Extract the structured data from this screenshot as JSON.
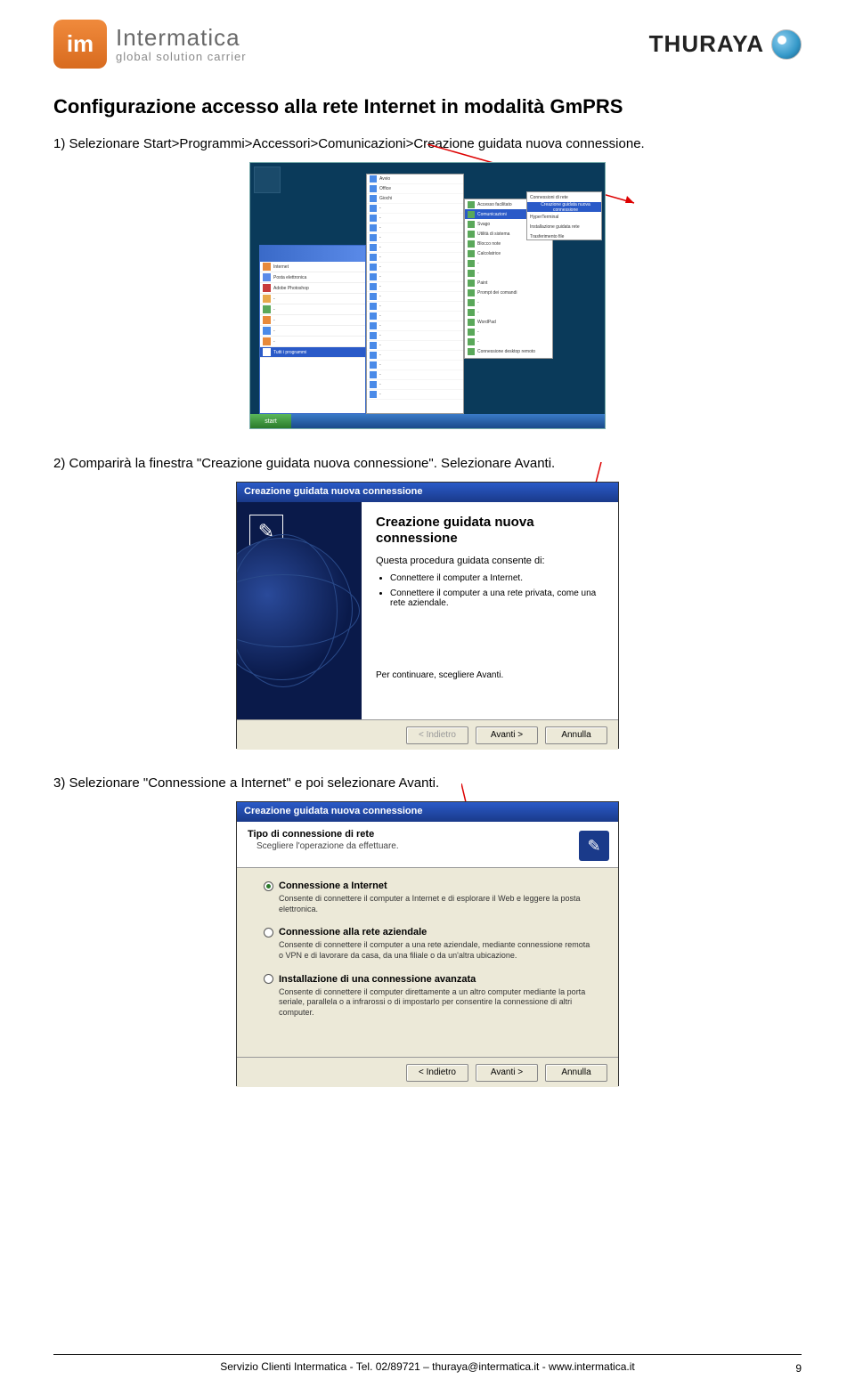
{
  "header": {
    "left_logo_abbr": "im",
    "left_logo_name": "Intermatica",
    "left_logo_tagline": "global solution carrier",
    "right_logo_text": "THURAYA"
  },
  "title": "Configurazione accesso alla rete Internet in modalità GmPRS",
  "step1": "1) Selezionare Start>Programmi>Accessori>Comunicazioni>Creazione guidata nuova connessione.",
  "step2": "2) Comparirà la finestra \"Creazione guidata nuova connessione\". Selezionare Avanti.",
  "step3": "3) Selezionare \"Connessione a Internet\" e poi selezionare Avanti.",
  "ss1": {
    "start_label": "start"
  },
  "ss2": {
    "titlebar": "Creazione guidata nuova connessione",
    "heading": "Creazione guidata nuova connessione",
    "sub": "Questa procedura guidata consente di:",
    "bullet1": "Connettere il computer a Internet.",
    "bullet2": "Connettere il computer a una rete privata, come una rete aziendale.",
    "continue": "Per continuare, scegliere Avanti.",
    "btn_back": "< Indietro",
    "btn_next": "Avanti >",
    "btn_cancel": "Annulla"
  },
  "ss3": {
    "titlebar": "Creazione guidata nuova connessione",
    "head_title": "Tipo di connessione di rete",
    "head_sub": "Scegliere l'operazione da effettuare.",
    "opt1_label": "Connessione a Internet",
    "opt1_desc": "Consente di connettere il computer a Internet e di esplorare il Web e leggere la posta elettronica.",
    "opt2_label": "Connessione alla rete aziendale",
    "opt2_desc": "Consente di connettere il computer a una rete aziendale, mediante connessione remota o VPN e di lavorare da casa, da una filiale o da un'altra ubicazione.",
    "opt3_label": "Installazione di una connessione avanzata",
    "opt3_desc": "Consente di connettere il computer direttamente a un altro computer mediante la porta seriale, parallela o a infrarossi o di impostarlo per consentire la connessione di altri computer.",
    "btn_back": "< Indietro",
    "btn_next": "Avanti >",
    "btn_cancel": "Annulla"
  },
  "footer": {
    "text": "Servizio Clienti Intermatica - Tel. 02/89721 – thuraya@intermatica.it - www.intermatica.it",
    "page": "9"
  }
}
